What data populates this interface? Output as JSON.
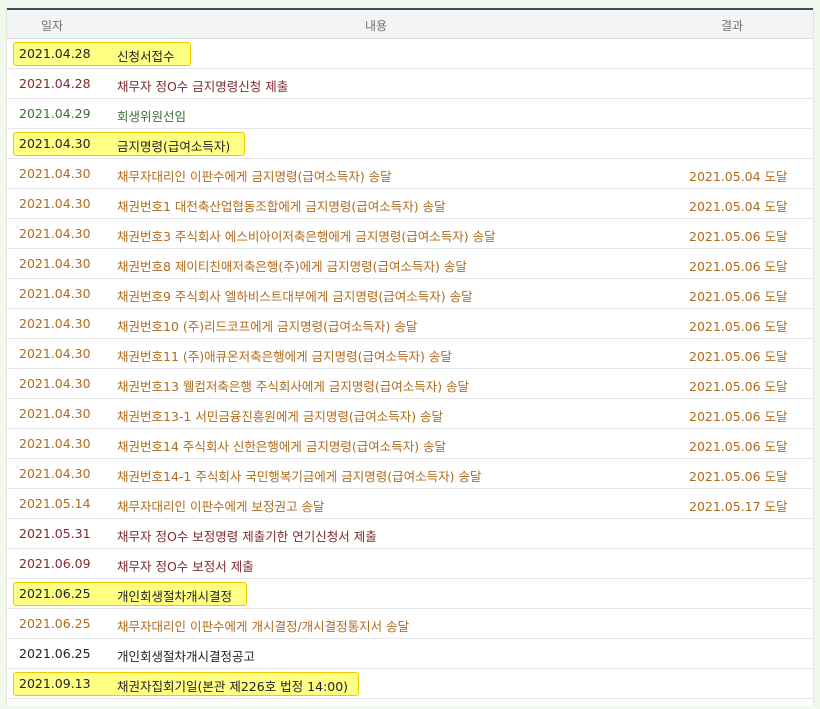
{
  "header": {
    "date": "일자",
    "content": "내용",
    "result": "결과"
  },
  "rows": [
    {
      "date": "2021.04.28",
      "content": "신청서접수",
      "result": ""
    },
    {
      "date": "2021.04.28",
      "content": "채무자 정O수 금지명령신청 제출",
      "result": ""
    },
    {
      "date": "2021.04.29",
      "content": "회생위원선임",
      "result": ""
    },
    {
      "date": "2021.04.30",
      "content": "금지명령(급여소득자)",
      "result": ""
    },
    {
      "date": "2021.04.30",
      "content": "채무자대리인 이판수에게 금지명령(급여소득자) 송달",
      "result": "2021.05.04 도달"
    },
    {
      "date": "2021.04.30",
      "content": "채권번호1 대전축산업협동조합에게 금지명령(급여소득자) 송달",
      "result": "2021.05.04 도달"
    },
    {
      "date": "2021.04.30",
      "content": "채권번호3 주식회사 에스비아이저축은행에게 금지명령(급여소득자) 송달",
      "result": "2021.05.06 도달"
    },
    {
      "date": "2021.04.30",
      "content": "채권번호8 제이티친애저축은행(주)에게 금지명령(급여소득자) 송달",
      "result": "2021.05.06 도달"
    },
    {
      "date": "2021.04.30",
      "content": "채권번호9 주식회사 엘하비스트대부에게 금지명령(급여소득자) 송달",
      "result": "2021.05.06 도달"
    },
    {
      "date": "2021.04.30",
      "content": "채권번호10 (주)리드코프에게 금지명령(급여소득자) 송달",
      "result": "2021.05.06 도달"
    },
    {
      "date": "2021.04.30",
      "content": "채권번호11 (주)애큐온저축은행에게 금지명령(급여소득자) 송달",
      "result": "2021.05.06 도달"
    },
    {
      "date": "2021.04.30",
      "content": "채권번호13 웰컴저축은행 주식회사에게 금지명령(급여소득자) 송달",
      "result": "2021.05.06 도달"
    },
    {
      "date": "2021.04.30",
      "content": "채권번호13-1 서민금융진흥원에게 금지명령(급여소득자) 송달",
      "result": "2021.05.06 도달"
    },
    {
      "date": "2021.04.30",
      "content": "채권번호14 주식회사 신한은행에게 금지명령(급여소득자) 송달",
      "result": "2021.05.06 도달"
    },
    {
      "date": "2021.04.30",
      "content": "채권번호14-1 주식회사 국민행복기금에게 금지명령(급여소득자) 송달",
      "result": "2021.05.06 도달"
    },
    {
      "date": "2021.05.14",
      "content": "채무자대리인 이판수에게 보정권고 송달",
      "result": "2021.05.17 도달"
    },
    {
      "date": "2021.05.31",
      "content": "채무자 정O수 보정명령 제출기한 연기신청서 제출",
      "result": ""
    },
    {
      "date": "2021.06.09",
      "content": "채무자 정O수 보정서 제출",
      "result": ""
    },
    {
      "date": "2021.06.25",
      "content": "개인회생절차개시결정",
      "result": ""
    },
    {
      "date": "2021.06.25",
      "content": "채무자대리인 이판수에게 개시결정/개시결정통지서 송달",
      "result": ""
    },
    {
      "date": "2021.06.25",
      "content": "개인회생절차개시결정공고",
      "result": ""
    },
    {
      "date": "2021.09.13",
      "content": "채권자집회기일(본관 제226호 법정 14:00)",
      "result": ""
    }
  ]
}
